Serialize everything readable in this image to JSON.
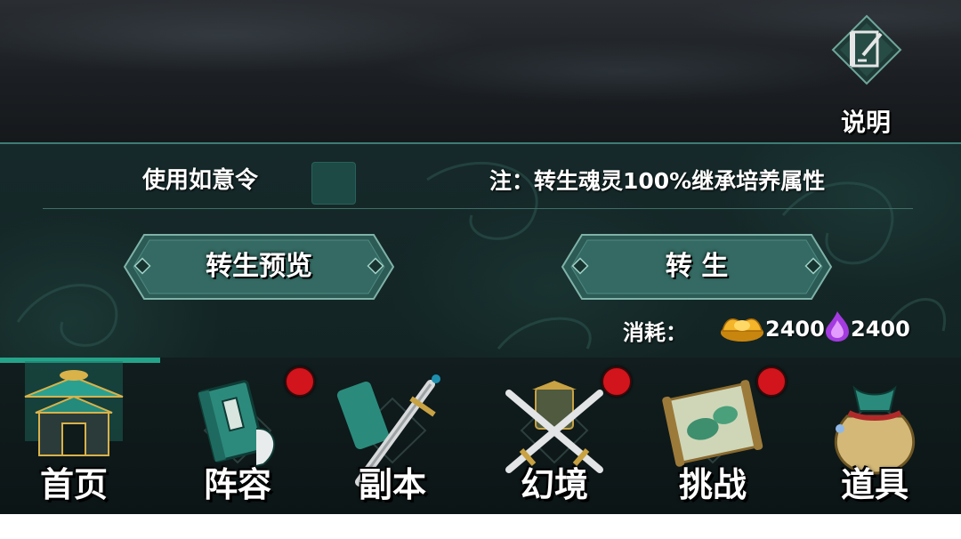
{
  "header": {
    "help_label": "说明"
  },
  "options": {
    "use_label": "使用如意令",
    "use_checked": false,
    "note": "注：转生魂灵100%继承培养属性"
  },
  "actions": {
    "preview_label": "转生预览",
    "rebirth_label": "转 生"
  },
  "cost": {
    "label": "消耗：",
    "gold_icon": "gold-ingot-icon",
    "gold_amount": "2400",
    "soul_icon": "purple-soul-flame-icon",
    "soul_amount": "2400"
  },
  "nav": {
    "items": [
      {
        "label": "首页",
        "icon": "pavilion-icon",
        "badge": false,
        "active": true
      },
      {
        "label": "阵容",
        "icon": "book-icon",
        "badge": true,
        "active": false
      },
      {
        "label": "副本",
        "icon": "sword-icon",
        "badge": false,
        "active": false
      },
      {
        "label": "幻境",
        "icon": "crossed-swords-icon",
        "badge": true,
        "active": false
      },
      {
        "label": "挑战",
        "icon": "scroll-map-icon",
        "badge": true,
        "active": false
      },
      {
        "label": "道具",
        "icon": "pouch-icon",
        "badge": false,
        "active": false
      }
    ]
  },
  "colors": {
    "accent": "#3e7d74",
    "badge": "#d2141c",
    "nav_active": "#24a389"
  }
}
